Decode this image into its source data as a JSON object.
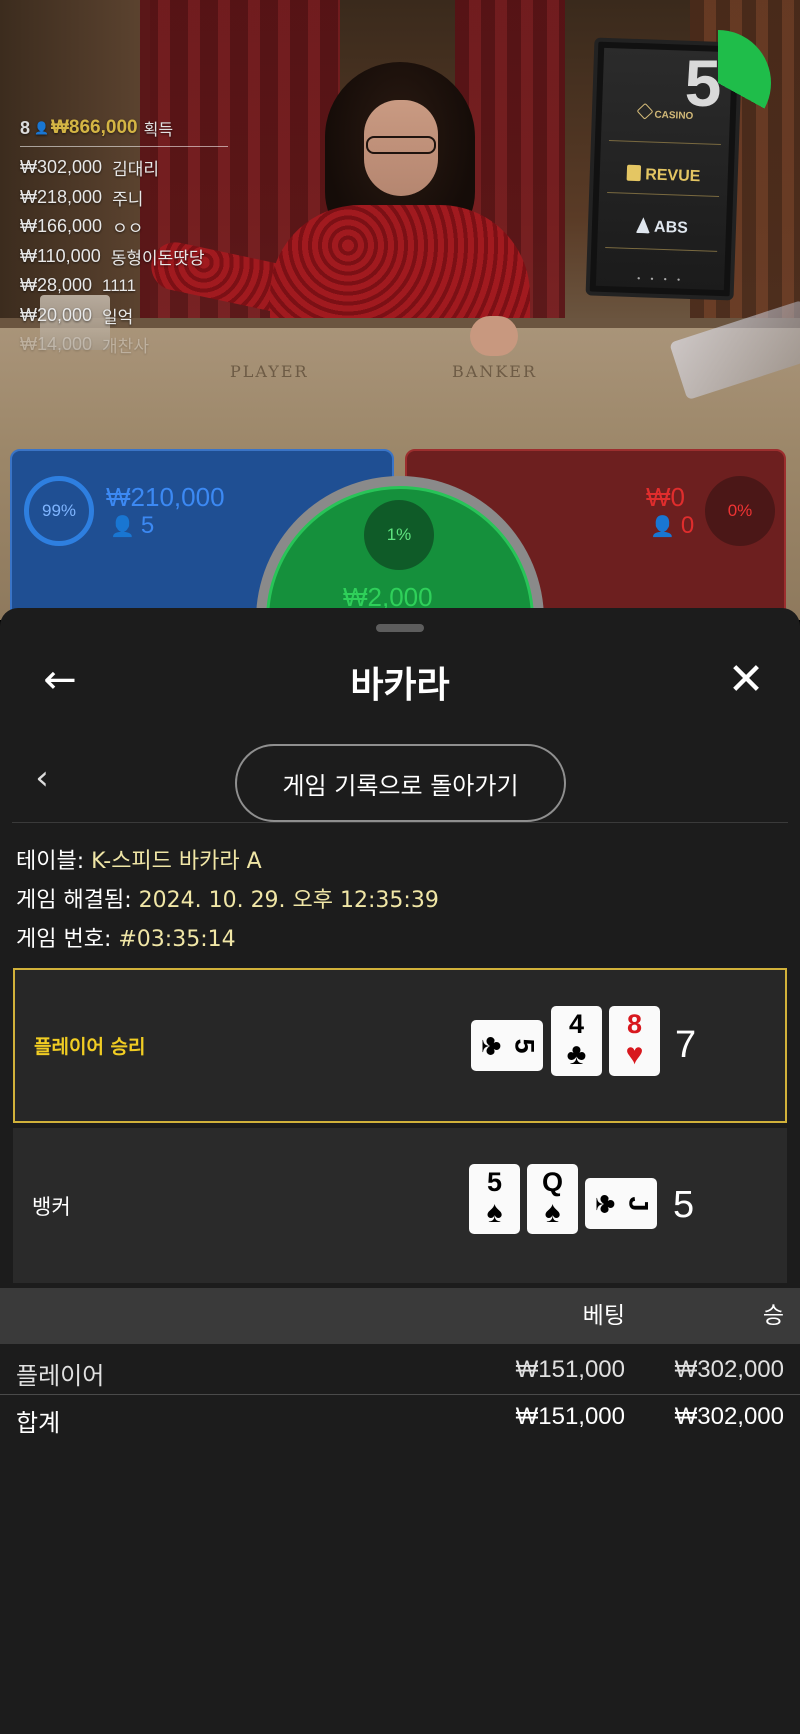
{
  "live": {
    "countdown": "5",
    "felt_player": "PLAYER",
    "felt_banker": "BANKER",
    "monitor": {
      "casino": "CASINO",
      "revue": "REVUE",
      "abs": "ABS",
      "dots": "• • • •"
    },
    "winners": {
      "count": "8",
      "total": "₩866,000",
      "label": "획득",
      "rows": [
        {
          "amount": "₩302,000",
          "name": "김대리"
        },
        {
          "amount": "₩218,000",
          "name": "주니"
        },
        {
          "amount": "₩166,000",
          "name": "ㅇㅇ"
        },
        {
          "amount": "₩110,000",
          "name": "동형이돈땃당"
        },
        {
          "amount": "₩28,000",
          "name": "1111"
        },
        {
          "amount": "₩20,000",
          "name": "일억"
        },
        {
          "amount": "₩14,000",
          "name": "개찬사"
        }
      ]
    },
    "bets": {
      "player": {
        "pct": "99%",
        "amount": "₩210,000",
        "count": "5"
      },
      "banker": {
        "pct": "0%",
        "amount": "₩0",
        "count": "0"
      },
      "tie": {
        "pct": "1%",
        "amount": "₩2,000"
      }
    }
  },
  "sheet": {
    "title": "바카라",
    "back_to_history": "게임 기록으로 돌아가기",
    "meta": {
      "table_label": "테이블:",
      "table_value": "K-스피드 바카라 A",
      "resolved_label": "게임 해결됨:",
      "resolved_value": "2024. 10. 29. 오후 12:35:39",
      "number_label": "게임 번호:",
      "number_value": "#03:35:14"
    },
    "results": {
      "player": {
        "label": "플레이어 승리",
        "score": "7",
        "cards": [
          {
            "rank": "5",
            "suit": "♣",
            "color": "black"
          },
          {
            "rank": "4",
            "suit": "♣",
            "color": "black"
          },
          {
            "rank": "8",
            "suit": "♥",
            "color": "red"
          }
        ]
      },
      "banker": {
        "label": "뱅커",
        "score": "5",
        "cards": [
          {
            "rank": "5",
            "suit": "♠",
            "color": "black"
          },
          {
            "rank": "Q",
            "suit": "♠",
            "color": "black"
          },
          {
            "rank": "J",
            "suit": "♣",
            "color": "black"
          }
        ]
      }
    },
    "totals": {
      "col_bet": "베팅",
      "col_win": "승",
      "rows": [
        {
          "label": "플레이어",
          "bet": "₩151,000",
          "win": "₩302,000"
        },
        {
          "label": "합계",
          "bet": "₩151,000",
          "win": "₩302,000"
        }
      ]
    }
  },
  "colors": {
    "player_blue": "#1f4f93",
    "banker_red": "#6d1f1f",
    "tie_green": "#15903c",
    "win_gold": "#d1b13a",
    "meta_value": "#f0e6a6"
  }
}
